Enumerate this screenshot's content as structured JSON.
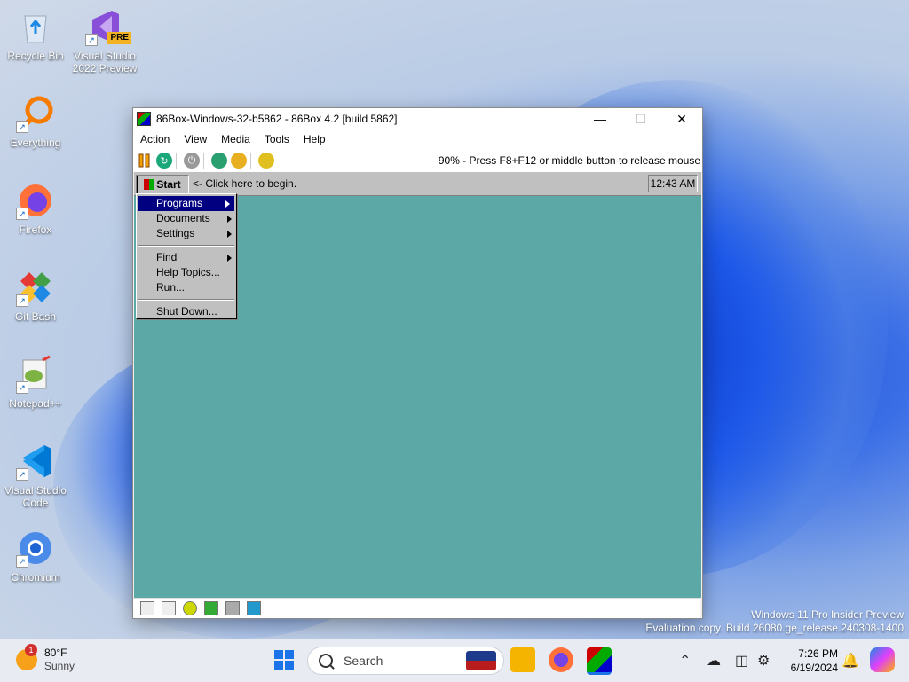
{
  "desktop": {
    "icons": [
      {
        "label": "Recycle Bin"
      },
      {
        "label": "Visual Studio 2022 Preview",
        "badge": "PRE"
      },
      {
        "label": "Everything"
      },
      {
        "label": "Firefox"
      },
      {
        "label": "Git Bash"
      },
      {
        "label": "Notepad++"
      },
      {
        "label": "Visual Studio Code"
      },
      {
        "label": "Chromium"
      }
    ]
  },
  "window": {
    "title": "86Box-Windows-32-b5862 - 86Box 4.2 [build 5862]",
    "menu": [
      "Action",
      "View",
      "Media",
      "Tools",
      "Help"
    ],
    "status_message": "90% - Press F8+F12 or middle button to release mouse"
  },
  "guest": {
    "start_label": "Start",
    "hint": "<- Click here to begin.",
    "clock": "12:43 AM",
    "start_menu": [
      "Programs",
      "Documents",
      "Settings",
      "Find",
      "Help Topics...",
      "Run...",
      "Shut Down..."
    ],
    "colors": {
      "desktop": "#5ba8a6",
      "highlight": "#000080"
    }
  },
  "watermark": {
    "line1": "Windows 11 Pro Insider Preview",
    "line2": "Evaluation copy. Build 26080.ge_release.240308-1400"
  },
  "taskbar": {
    "weather_temp": "80°F",
    "weather_cond": "Sunny",
    "weather_badge": "1",
    "search_placeholder": "Search",
    "time": "7:26 PM",
    "date": "6/19/2024"
  }
}
